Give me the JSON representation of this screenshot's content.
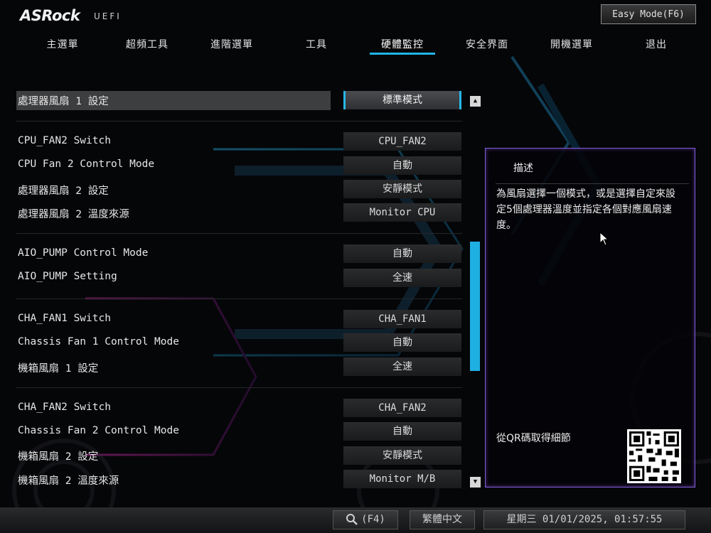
{
  "header": {
    "brand": "ASRock",
    "subtitle": "UEFI",
    "easy_mode": "Easy Mode(F6)"
  },
  "tabs": [
    {
      "label": "主選單"
    },
    {
      "label": "超頻工具"
    },
    {
      "label": "進階選單"
    },
    {
      "label": "工具"
    },
    {
      "label": "硬體監控",
      "active": true
    },
    {
      "label": "安全界面"
    },
    {
      "label": "開機選單"
    },
    {
      "label": "退出"
    }
  ],
  "settings": [
    {
      "label": "處理器風扇 1 設定",
      "value": "標準模式",
      "selected": true
    },
    {
      "label": "CPU_FAN2 Switch",
      "value": "CPU_FAN2"
    },
    {
      "label": "CPU Fan 2 Control Mode",
      "value": "自動"
    },
    {
      "label": "處理器風扇 2 設定",
      "value": "安靜模式"
    },
    {
      "label": "處理器風扇 2 溫度來源",
      "value": "Monitor CPU"
    },
    {
      "label": "AIO_PUMP Control Mode",
      "value": "自動"
    },
    {
      "label": "AIO_PUMP Setting",
      "value": "全速"
    },
    {
      "label": "CHA_FAN1 Switch",
      "value": "CHA_FAN1"
    },
    {
      "label": "Chassis Fan 1 Control Mode",
      "value": "自動"
    },
    {
      "label": "機箱風扇 1 設定",
      "value": "全速"
    },
    {
      "label": "CHA_FAN2 Switch",
      "value": "CHA_FAN2"
    },
    {
      "label": "Chassis Fan 2 Control Mode",
      "value": "自動"
    },
    {
      "label": "機箱風扇 2 設定",
      "value": "安靜模式"
    },
    {
      "label": "機箱風扇 2 溫度來源",
      "value": "Monitor M/B"
    }
  ],
  "description": {
    "title": "描述",
    "text": "為風扇選擇一個模式，或是選擇自定來設定5個處理器溫度並指定各個對應風扇速度。",
    "qr_label": "從QR碼取得細節"
  },
  "footer": {
    "search_key": "(F4)",
    "language": "繁體中文",
    "datetime": "星期三 01/01/2025, 01:57:55"
  },
  "colors": {
    "accent": "#1fb6e6",
    "panel_border": "#7b5fd6"
  },
  "icons": {
    "search": "search-icon",
    "scroll_up": "chevron-up-icon",
    "scroll_down": "chevron-down-icon",
    "cursor": "mouse-pointer-icon"
  }
}
